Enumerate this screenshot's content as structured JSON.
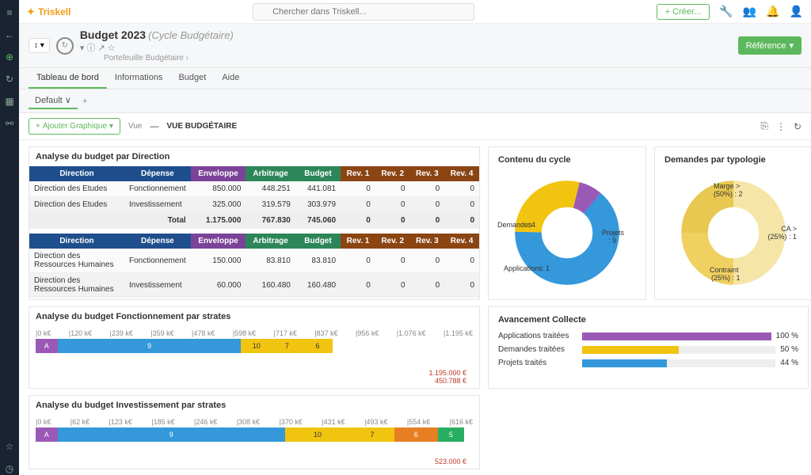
{
  "logo": "Triskell",
  "search_placeholder": "Chercher dans Triskell...",
  "create_btn": "+ Créer...",
  "header": {
    "title": "Budget 2023",
    "subtitle": "(Cycle Budgétaire)",
    "crumb": "Portefeuille Budgétaire  ›",
    "ref_btn": "Référence"
  },
  "tabs": [
    "Tableau de bord",
    "Informations",
    "Budget",
    "Aide"
  ],
  "subtab": "Default",
  "toolbar": {
    "add": "Ajouter Graphique",
    "view_lbl": "Vue",
    "view_val": "VUE BUDGÉTAIRE"
  },
  "panels": {
    "t1_title": "Analyse du budget par Direction",
    "t2_title": "Contenu du cycle",
    "t3_title": "Demandes par typologie",
    "t4_title": "Analyse du budget Fonctionnement par strates",
    "t5_title": "Avancement Collecte",
    "t6_title": "Analyse du budget Investissement par strates"
  },
  "th": {
    "dir": "Direction",
    "dep": "Dépense",
    "env": "Enveloppe",
    "arb": "Arbitrage",
    "bud": "Budget",
    "r1": "Rev. 1",
    "r2": "Rev. 2",
    "r3": "Rev. 3",
    "r4": "Rev. 4",
    "total": "Total"
  },
  "tbl1": [
    {
      "dir": "Direction des Etudes",
      "dep": "Fonctionnement",
      "env": "850.000",
      "arb": "448.251",
      "bud": "441.081",
      "r1": "0",
      "r2": "0",
      "r3": "0",
      "r4": "0"
    },
    {
      "dir": "Direction des Etudes",
      "dep": "Investissement",
      "env": "325.000",
      "arb": "319.579",
      "bud": "303.979",
      "r1": "0",
      "r2": "0",
      "r3": "0",
      "r4": "0"
    }
  ],
  "tbl1_total": {
    "env": "1.175.000",
    "arb": "767.830",
    "bud": "745.060",
    "r1": "0",
    "r2": "0",
    "r3": "0",
    "r4": "0"
  },
  "tbl2": [
    {
      "dir": "Direction des Ressources Humaines",
      "dep": "Fonctionnement",
      "env": "150.000",
      "arb": "83.810",
      "bud": "83.810",
      "r1": "0",
      "r2": "0",
      "r3": "0",
      "r4": "0"
    },
    {
      "dir": "Direction des Ressources Humaines",
      "dep": "Investissement",
      "env": "60.000",
      "arb": "160.480",
      "bud": "160.480",
      "r1": "0",
      "r2": "0",
      "r3": "0",
      "r4": "0"
    }
  ],
  "chart_data": [
    {
      "type": "pie",
      "title": "Contenu du cycle",
      "series": [
        {
          "name": "Projets",
          "value": 9,
          "color": "#3498db"
        },
        {
          "name": "Demandes",
          "value": 4,
          "color": "#f1c40f"
        },
        {
          "name": "Applications",
          "value": 1,
          "color": "#9b59b6"
        }
      ]
    },
    {
      "type": "pie",
      "title": "Demandes par typologie",
      "series": [
        {
          "name": "Marge > (50%)",
          "value": 2,
          "color": "#f5e6a8"
        },
        {
          "name": "CA > (25%)",
          "value": 1,
          "color": "#f0d060"
        },
        {
          "name": "Contraint (25%)",
          "value": 1,
          "color": "#e8c850"
        }
      ]
    }
  ],
  "strata1": {
    "axis": [
      "0 k€",
      "120 k€",
      "239 k€",
      "359 k€",
      "478 k€",
      "598 k€",
      "717 k€",
      "837 k€",
      "956 k€",
      "1.076 k€",
      "1.195 k€"
    ],
    "segs": [
      {
        "l": "A",
        "c": "p",
        "w": 5
      },
      {
        "l": "9",
        "c": "b",
        "w": 42
      },
      {
        "l": "10",
        "c": "y",
        "w": 7
      },
      {
        "l": "7",
        "c": "y",
        "w": 7
      },
      {
        "l": "6",
        "c": "y",
        "w": 7
      }
    ],
    "totals": [
      "1.195.000 €",
      "450.788 €"
    ]
  },
  "strata2": {
    "axis": [
      "0 k€",
      "62 k€",
      "123 k€",
      "185 k€",
      "246 k€",
      "308 k€",
      "370 k€",
      "431 k€",
      "493 k€",
      "554 k€",
      "616 k€"
    ],
    "segs": [
      {
        "l": "A",
        "c": "p",
        "w": 5
      },
      {
        "l": "9",
        "c": "b",
        "w": 52
      },
      {
        "l": "10",
        "c": "y",
        "w": 15
      },
      {
        "l": "7",
        "c": "y",
        "w": 10
      },
      {
        "l": "6",
        "c": "o",
        "w": 10
      },
      {
        "l": "5",
        "c": "g",
        "w": 6
      }
    ],
    "total": "523.000 €"
  },
  "progress": [
    {
      "label": "Applications traitées",
      "pct": 100,
      "color": "#9b59b6",
      "txt": "100 %"
    },
    {
      "label": "Demandes traitées",
      "pct": 50,
      "color": "#f1c40f",
      "txt": "50 %"
    },
    {
      "label": "Projets traités",
      "pct": 44,
      "color": "#3498db",
      "txt": "44 %"
    }
  ]
}
